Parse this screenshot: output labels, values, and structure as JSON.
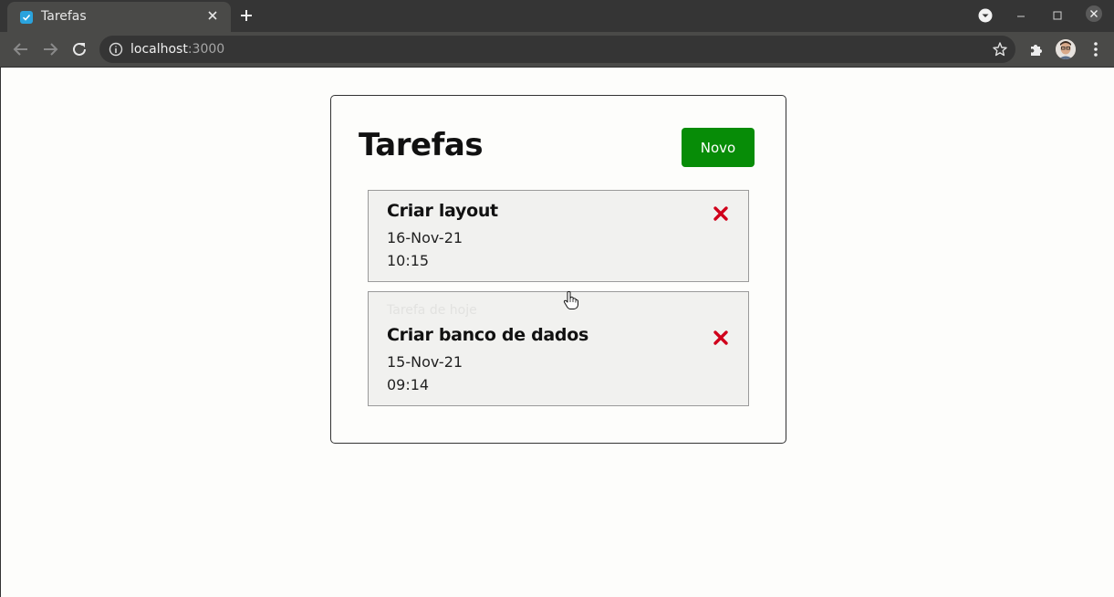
{
  "browser": {
    "tab_title": "Tarefas",
    "url_host": "localhost",
    "url_port": ":3000"
  },
  "app": {
    "title": "Tarefas",
    "new_button_label": "Novo",
    "tasks": [
      {
        "title": "Criar layout",
        "date": "16-Nov-21",
        "time": "10:15"
      },
      {
        "hint": "Tarefa de hoje",
        "title": "Criar banco de dados",
        "date": "15-Nov-21",
        "time": "09:14"
      }
    ]
  },
  "colors": {
    "accent_green": "#078c07",
    "delete_red": "#d0021b",
    "favicon_blue": "#2aa3dd"
  },
  "icons": [
    "check-favicon-icon",
    "close-icon",
    "plus-icon",
    "profile-dropdown-icon",
    "minimize-icon",
    "maximize-icon",
    "close-window-icon",
    "back-icon",
    "forward-icon",
    "reload-icon",
    "info-icon",
    "star-icon",
    "puzzle-icon",
    "kebab-menu-icon",
    "delete-icon",
    "hand-cursor-icon"
  ]
}
